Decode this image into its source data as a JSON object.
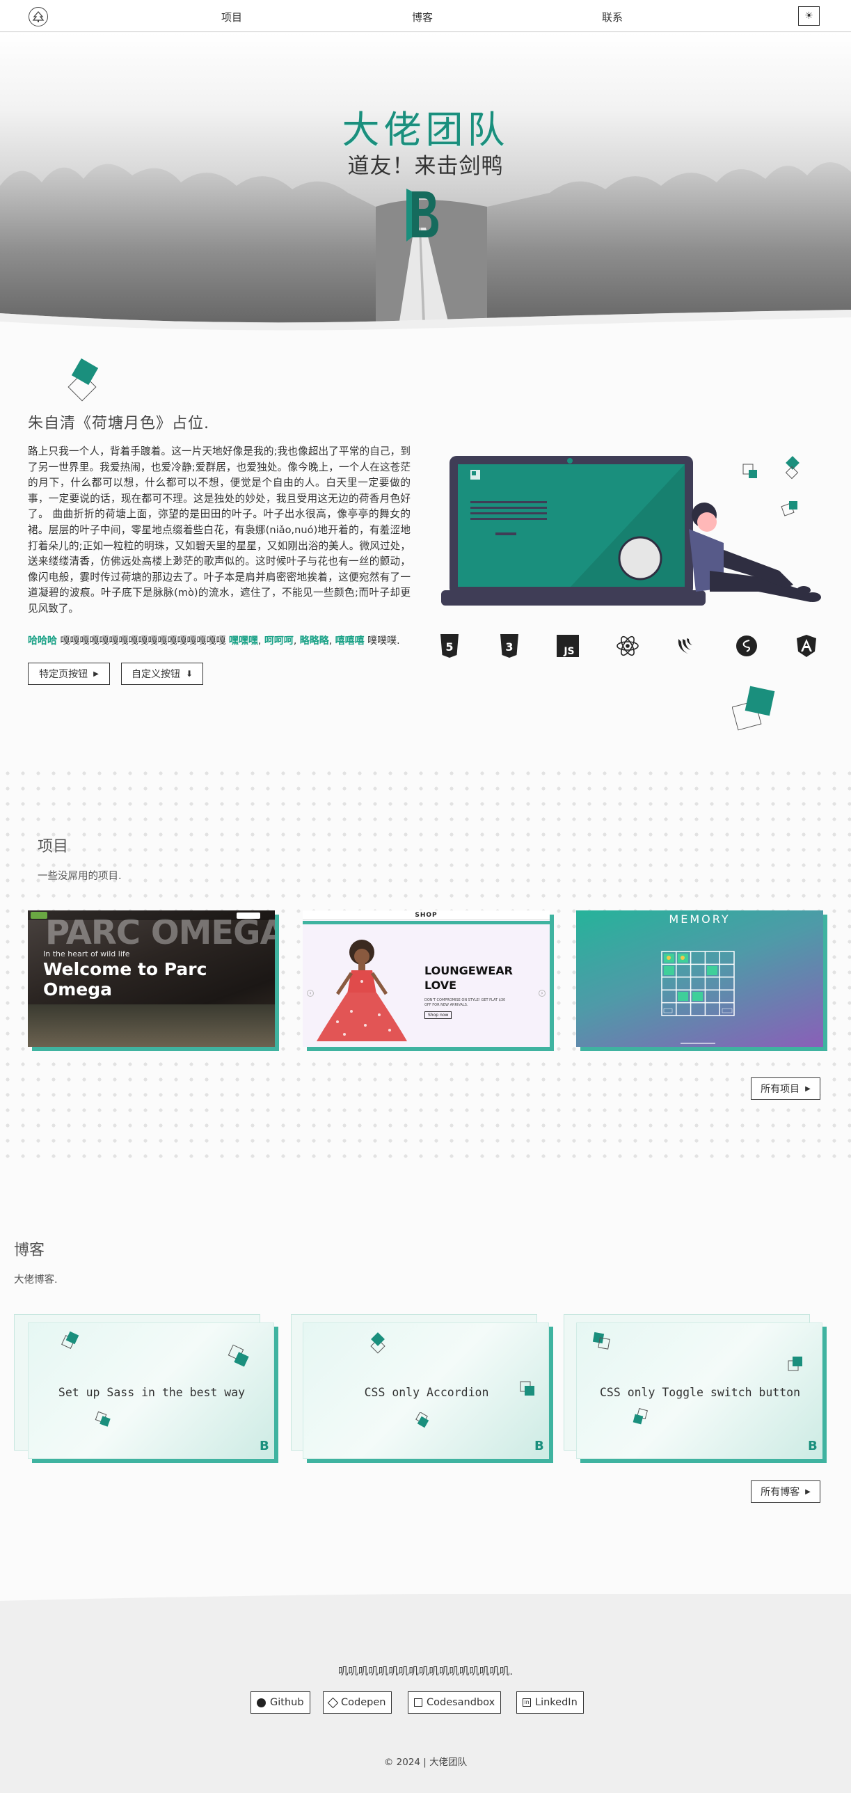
{
  "nav": {
    "links": [
      "项目",
      "博客",
      "联系"
    ],
    "theme_icon": "☀"
  },
  "hero": {
    "title": "大佬团队",
    "subtitle": "道友！来击剑鸭",
    "brand_color": "#1a8f7d"
  },
  "about": {
    "title": "朱自清《荷塘月色》占位.",
    "text": "路上只我一个人，背着手踱着。这一片天地好像是我的;我也像超出了平常的自己，到了另一世界里。我爱热闹，也爱冷静;爱群居，也爱独处。像今晚上，一个人在这苍茫的月下，什么都可以想，什么都可以不想，便觉是个自由的人。白天里一定要做的事，一定要说的话，现在都可不理。这是独处的妙处，我且受用这无边的荷香月色好了。 曲曲折折的荷塘上面，弥望的是田田的叶子。叶子出水很高，像亭亭的舞女的裙。层层的叶子中间，零星地点缀着些白花，有袅娜(niǎo,nuó)地开着的，有羞涩地打着朵儿的;正如一粒粒的明珠，又如碧天里的星星，又如刚出浴的美人。微风过处，送来缕缕清香，仿佛远处高楼上渺茫的歌声似的。这时候叶子与花也有一丝的颤动，像闪电般，霎时传过荷塘的那边去了。叶子本是肩并肩密密地挨着，这便宛然有了一道凝碧的波痕。叶子底下是脉脉(mò)的流水，遮住了，不能见一些颜色;而叶子却更见风致了。",
    "tagline": [
      {
        "text": "哈哈哈",
        "accent": true
      },
      {
        "text": " 嘎嘎嘎嘎嘎嘎嘎嘎嘎嘎嘎嘎嘎嘎嘎嘎嘎 ",
        "accent": false
      },
      {
        "text": "嘿嘿嘿",
        "accent": true
      },
      {
        "text": ", ",
        "accent": false
      },
      {
        "text": "呵呵呵",
        "accent": true
      },
      {
        "text": ", ",
        "accent": false
      },
      {
        "text": "略略略",
        "accent": true
      },
      {
        "text": ", ",
        "accent": false
      },
      {
        "text": "嘻嘻嘻",
        "accent": true
      },
      {
        "text": " 噗噗噗.",
        "accent": false
      }
    ],
    "button_page": "特定页按钮",
    "button_custom": "自定义按钮",
    "tech_icons": [
      "html5-icon",
      "css3-icon",
      "javascript-icon",
      "react-icon",
      "jquery-icon",
      "sass-icon",
      "angular-icon"
    ]
  },
  "projects": {
    "title": "项目",
    "subtitle": "一些没屌用的项目.",
    "cards": [
      {
        "name": "parc-omega",
        "big": "PARC OMEGA",
        "kicker": "In the heart of wild life",
        "heading": "Welcome to Parc Omega"
      },
      {
        "name": "shop",
        "brand": "SHOP",
        "heading": "LOUNGEWEAR LOVE",
        "small": "DON'T COMPROMISE ON STYLE! GET FLAT $30 OFF FOR NEW ARRIVALS.",
        "cta": "Shop now"
      },
      {
        "name": "memory",
        "heading": "MEMORY"
      }
    ],
    "all_button": "所有项目"
  },
  "blog": {
    "title": "博客",
    "subtitle": "大佬博客.",
    "cards": [
      "Set up Sass in the best way",
      "CSS only Accordion",
      "CSS only Toggle switch button"
    ],
    "all_button": "所有博客"
  },
  "footer": {
    "text": "叽叽叽叽叽叽叽叽叽叽叽叽叽叽叽叽叽.",
    "links": [
      {
        "icon": "github-icon",
        "label": "Github"
      },
      {
        "icon": "codepen-icon",
        "label": "Codepen"
      },
      {
        "icon": "codesandbox-icon",
        "label": "Codesandbox"
      },
      {
        "icon": "linkedin-icon",
        "label": "LinkedIn"
      }
    ],
    "copyright": "© 2024 | 大佬团队"
  },
  "colors": {
    "accent": "#17a085",
    "card_shadow": "#3fb3a0",
    "dark": "#333333"
  }
}
